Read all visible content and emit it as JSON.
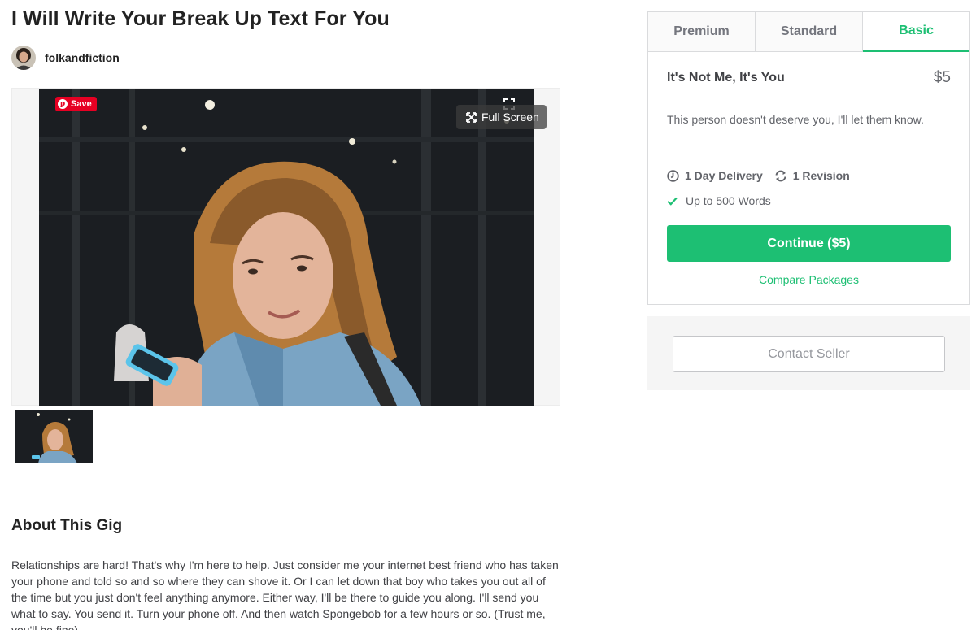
{
  "gig": {
    "title": "I Will Write Your Break Up Text For You"
  },
  "seller": {
    "username": "folkandfiction"
  },
  "gallery": {
    "save_label": "Save",
    "fullscreen_label": "Full Screen"
  },
  "about": {
    "heading": "About This Gig",
    "body": "Relationships are hard! That's why I'm here to help. Just consider me your internet best friend who has taken your phone and told so and so where they can shove it. Or I can let down that boy who takes you out all of the time but you just don't feel anything anymore. Either way, I'll be there to guide you along. I'll send you what to say. You send it. Turn your phone off. And then watch Spongebob for a few hours or so. (Trust me, you'll be fine)."
  },
  "packages": {
    "tabs": [
      {
        "label": "Premium",
        "active": false
      },
      {
        "label": "Standard",
        "active": false
      },
      {
        "label": "Basic",
        "active": true
      }
    ],
    "selected": {
      "name": "It's Not Me, It's You",
      "price": "$5",
      "description": "This person doesn't deserve you, I'll let them know.",
      "delivery": "1 Day Delivery",
      "revisions": "1 Revision",
      "features": [
        "Up to 500 Words"
      ]
    },
    "continue_label": "Continue ($5)",
    "compare_label": "Compare Packages"
  },
  "contact": {
    "button_label": "Contact Seller"
  },
  "colors": {
    "accent_green": "#1dbf73",
    "pinterest_red": "#e60023",
    "text_dark": "#222222",
    "text_muted": "#62646a"
  }
}
